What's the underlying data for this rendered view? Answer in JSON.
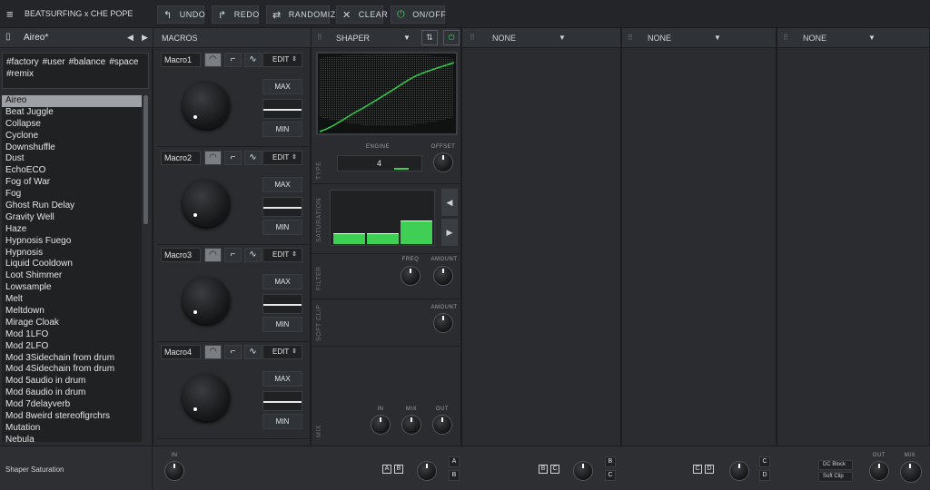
{
  "topbar": {
    "title": "BEATSURFING x CHE POPE",
    "undo": "UNDO",
    "redo": "REDO",
    "randomize": "RANDOMIZE",
    "clear": "CLEAR",
    "onoff": "ON/OFF"
  },
  "preset": {
    "name": "Aireo*"
  },
  "tags": [
    "#factory",
    "#user",
    "#balance",
    "#space",
    "#remix"
  ],
  "presets": [
    "Aireo",
    "Beat Juggle",
    "Collapse",
    "Cyclone",
    "Downshuffle",
    "Dust",
    "EchoECO",
    "Fog of War",
    "Fog",
    "Ghost Run Delay",
    "Gravity Well",
    "Haze",
    "Hypnosis Fuego",
    "Hypnosis",
    "Liquid Cooldown",
    "Loot Shimmer",
    "Lowsample",
    "Melt",
    "Meltdown",
    "Mirage Cloak",
    "Mod 1LFO",
    "Mod 2LFO",
    "Mod 3Sidechain from drum",
    "Mod 4Sidechain from drum",
    "Mod 5audio in drum",
    "Mod 6audio in drum",
    "Mod 7delayverb",
    "Mod 8weird stereoflgrchrs",
    "Mutation",
    "Nebula"
  ],
  "macros": {
    "title": "MACROS",
    "edit": "EDIT",
    "max": "MAX",
    "min": "MIN",
    "names": [
      "Macro1",
      "Macro2",
      "Macro3",
      "Macro4"
    ]
  },
  "shaper": {
    "title": "SHAPER",
    "engine_label": "ENGINE",
    "engine_value": "4",
    "offset": "OFFSET",
    "type": "TYPE",
    "saturation": "SATURATION",
    "filter": "FILTER",
    "freq": "FREQ",
    "amount": "AMOUNT",
    "softclip": "SOFT CLIP",
    "mix": "MIX",
    "in": "IN",
    "mix_knob": "MIX",
    "out": "OUT",
    "sat_levels": [
      0.2,
      0.2,
      0.45
    ]
  },
  "slots": [
    "NONE",
    "NONE",
    "NONE"
  ],
  "bottom": {
    "name": "Shaper Saturation",
    "in": "IN",
    "out": "OUT",
    "mix": "MIX",
    "dc_block": "DC Block",
    "soft_clip": "Soft Clip",
    "a": "A",
    "b": "B",
    "c": "C",
    "d": "D"
  },
  "colors": {
    "accent": "#3fcf55",
    "bg": "#2b2d30"
  }
}
